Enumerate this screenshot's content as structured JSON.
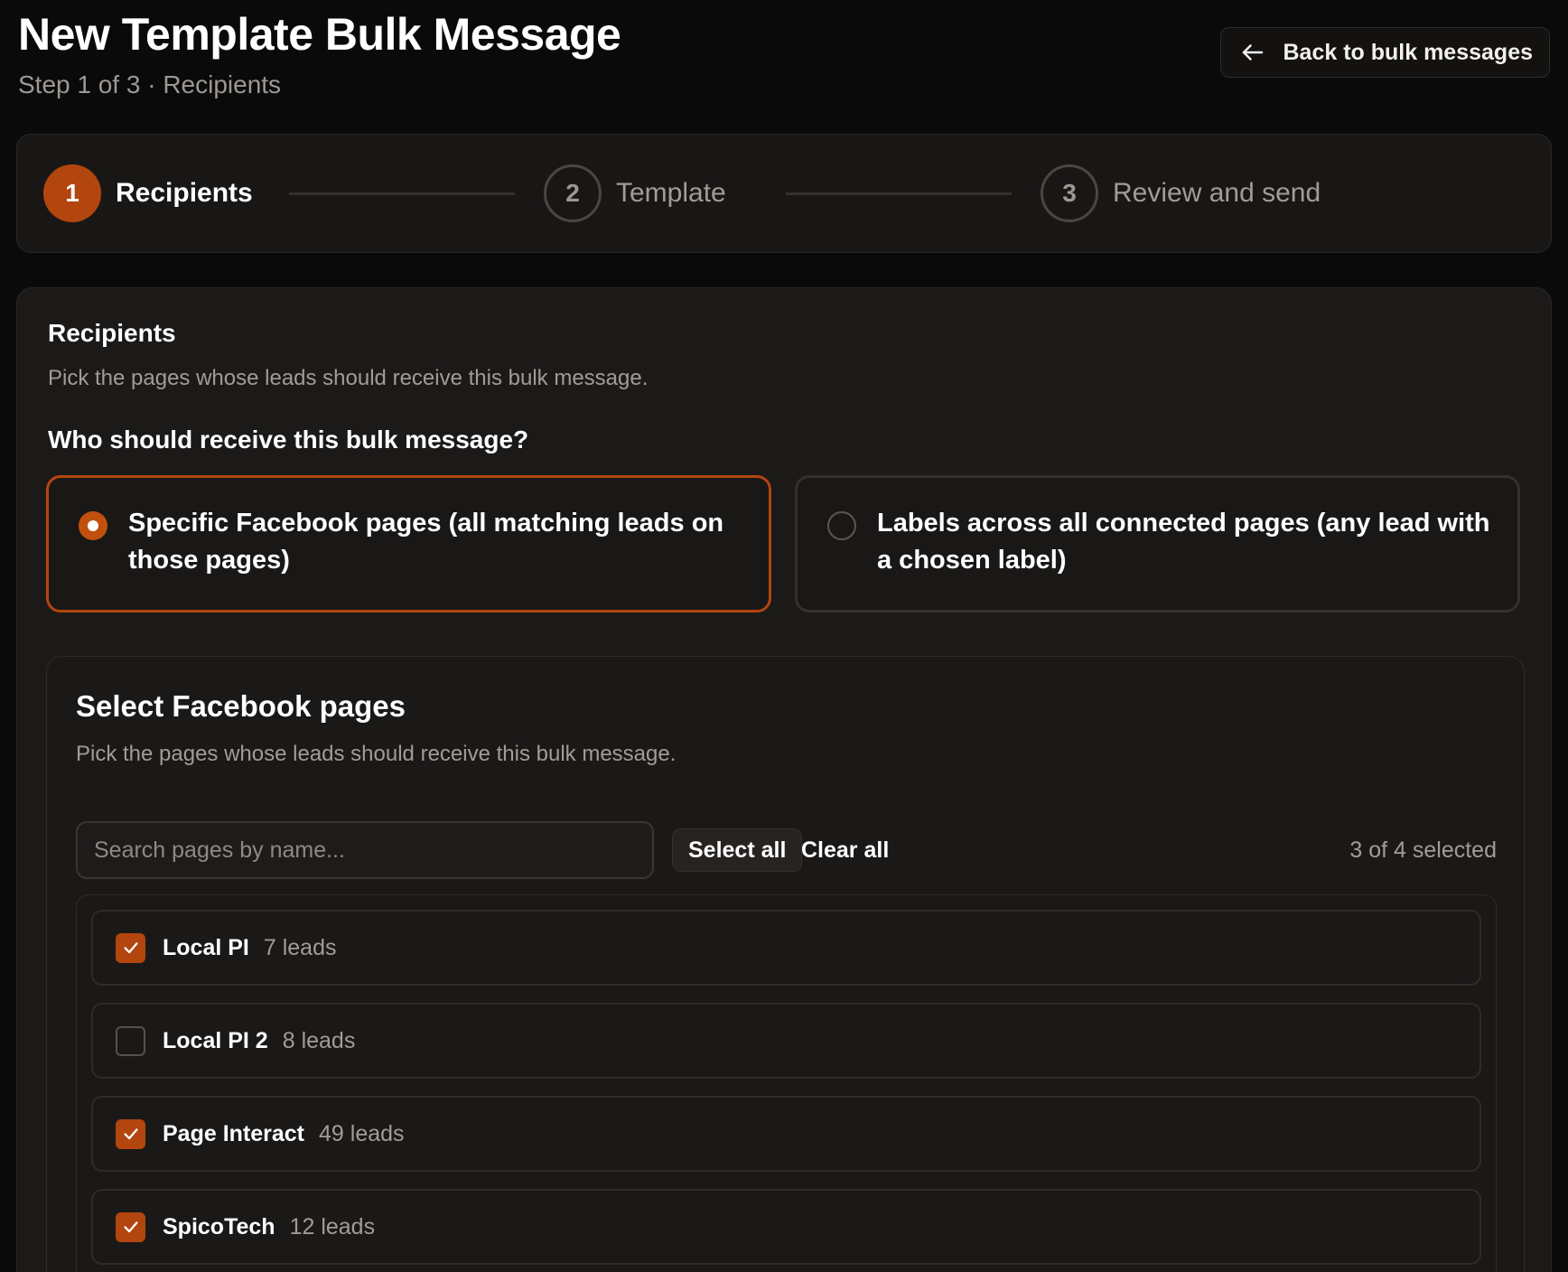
{
  "header": {
    "title": "New Template Bulk Message",
    "subtitle": "Step 1 of 3 · Recipients",
    "back_label": "Back to bulk messages"
  },
  "stepper": {
    "steps": [
      {
        "number": "1",
        "label": "Recipients",
        "active": true
      },
      {
        "number": "2",
        "label": "Template",
        "active": false
      },
      {
        "number": "3",
        "label": "Review and send",
        "active": false
      }
    ]
  },
  "recipients": {
    "title": "Recipients",
    "description": "Pick the pages whose leads should receive this bulk message.",
    "question": "Who should receive this bulk message?",
    "options": [
      {
        "label": "Specific Facebook pages (all matching leads on those pages)",
        "selected": true
      },
      {
        "label": "Labels across all connected pages (any lead with a chosen label)",
        "selected": false
      }
    ]
  },
  "pages_panel": {
    "title": "Select Facebook pages",
    "description": "Pick the pages whose leads should receive this bulk message.",
    "search_placeholder": "Search pages by name...",
    "search_value": "",
    "select_all_label": "Select all",
    "clear_all_label": "Clear all",
    "selected_count": "3 of 4 selected",
    "pages": [
      {
        "name": "Local PI",
        "leads": "7 leads",
        "checked": true
      },
      {
        "name": "Local PI 2",
        "leads": "8 leads",
        "checked": false
      },
      {
        "name": "Page Interact",
        "leads": "49 leads",
        "checked": true
      },
      {
        "name": "SpicoTech",
        "leads": "12 leads",
        "checked": true
      }
    ]
  },
  "icons": {
    "back": "arrow-left-icon",
    "check": "checkmark-icon"
  },
  "colors": {
    "accent": "#b3450f",
    "background": "#0b0a0a",
    "card": "#1c1a19"
  }
}
